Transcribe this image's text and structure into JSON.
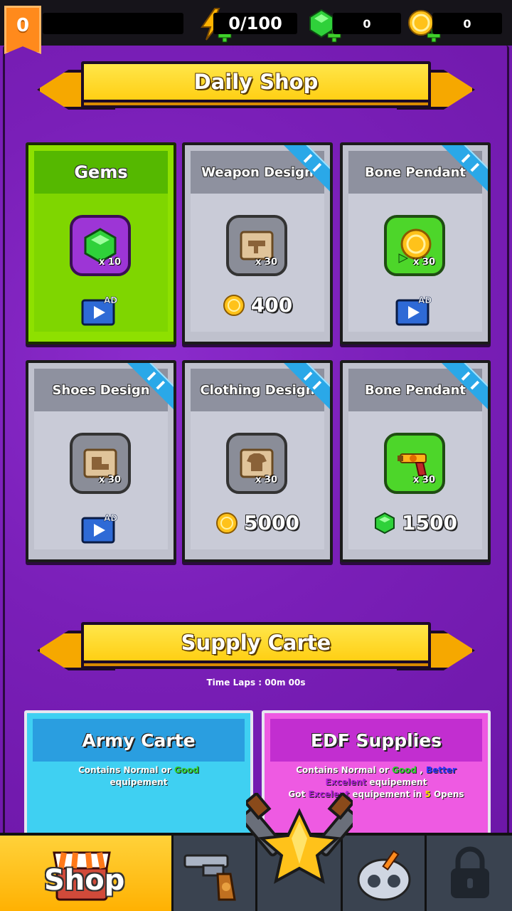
{
  "topbar": {
    "level": "0",
    "energy": "0/100",
    "gems": "0",
    "coins": "0"
  },
  "daily_shop": {
    "title": "Daily Shop",
    "items": [
      {
        "title": "Gems",
        "qty": "x 10",
        "price": null,
        "ad": "AD"
      },
      {
        "title": "Weapon Design",
        "qty": "x 30",
        "price": "400",
        "ad": null
      },
      {
        "title": "Bone Pendant",
        "qty": "x 30",
        "price": null,
        "ad": "AD"
      },
      {
        "title": "Shoes Design",
        "qty": "x 30",
        "price": null,
        "ad": "AD"
      },
      {
        "title": "Clothing Design",
        "qty": "x 30",
        "price": "5000",
        "ad": null
      },
      {
        "title": "Bone Pendant",
        "qty": "x 30",
        "price": "1500",
        "ad": null
      }
    ]
  },
  "supply": {
    "title": "Supply Carte",
    "timer": "Time Laps : 00m 00s",
    "army": {
      "title": "Army Carte",
      "line1_a": "Contains Normal or ",
      "line1_good": "Good",
      "line2": "equipement"
    },
    "edf": {
      "title": "EDF Supplies",
      "line1_a": "Contains Normal or ",
      "line1_good": "Good",
      "line1_b": " , ",
      "line1_better": "Better",
      "line2_excellent": "Excelent",
      "line2_b": " equipement",
      "line3_a": "Got ",
      "line3_excellent": "Excelent",
      "line3_b": " equipement in ",
      "line3_num": "5",
      "line3_c": " Opens"
    }
  },
  "nav": {
    "shop_label": "Shop"
  },
  "colors": {
    "background": "#7a1fb8",
    "banner": "#ffd21f",
    "shop_tab": "#ffc21a"
  }
}
